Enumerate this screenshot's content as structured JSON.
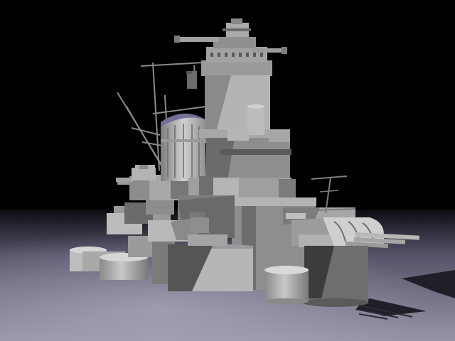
{
  "scene": {
    "subject": "warship-superstructure-3d-render",
    "colors": {
      "sky": "#000000",
      "floor_far": "#0c0c12",
      "floor_near": "#8e8d9c",
      "hull_light": "#b9b9b9",
      "hull_mid": "#8e8e8e",
      "hull_dark": "#5a5a5a",
      "hull_shadow": "#3a3a3a",
      "funnel_cap": "#6f6f9a",
      "ground_shadow": "#1c1c24"
    }
  }
}
